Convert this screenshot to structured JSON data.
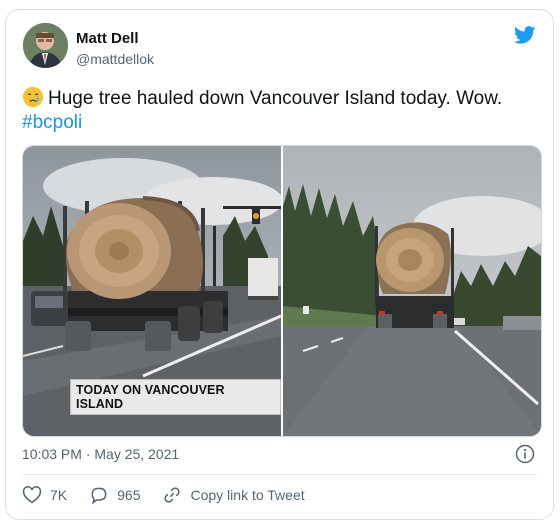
{
  "user": {
    "name": "Matt Dell",
    "handle": "@mattdellok"
  },
  "tweet": {
    "emoji": "crying-face-emoji",
    "text": "Huge tree hauled down Vancouver Island today. Wow.",
    "hashtag": "#bcpoli"
  },
  "media": {
    "left_caption": "TODAY ON VANCOUVER ISLAND"
  },
  "meta": {
    "timestamp": "10:03 PM · May 25, 2021"
  },
  "actions": {
    "likes": "7K",
    "replies": "965",
    "copy_link": "Copy link to Tweet"
  },
  "colors": {
    "brand": "#1d9bf0",
    "hashtag": "#1b95e0",
    "secondary_text": "#536471"
  },
  "icons": [
    "twitter-bird-icon",
    "info-icon",
    "heart-icon",
    "reply-icon",
    "link-icon"
  ]
}
